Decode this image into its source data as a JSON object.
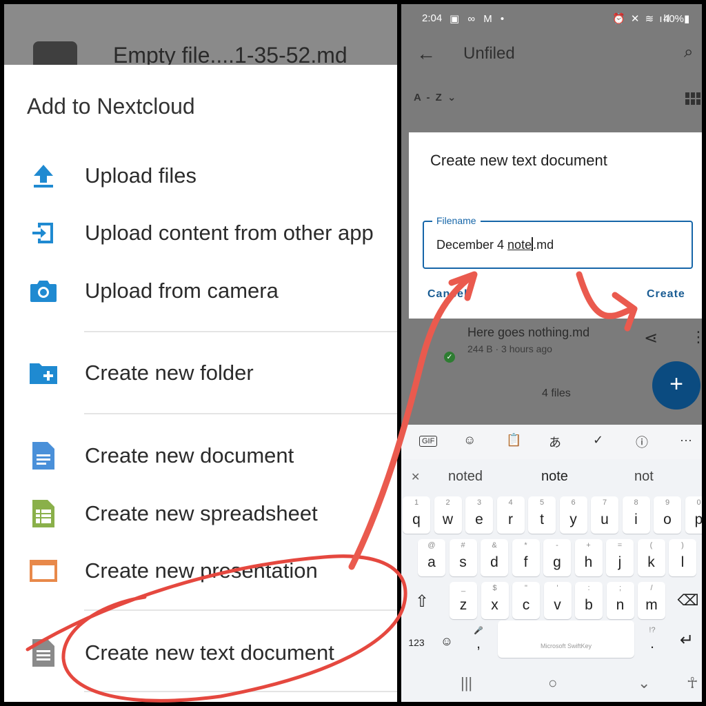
{
  "left": {
    "background_file": {
      "name": "Empty file....1-35-52.md"
    },
    "sheet": {
      "title": "Add to Nextcloud",
      "items": [
        {
          "label": "Upload files",
          "icon": "upload-icon"
        },
        {
          "label": "Upload content from other app",
          "icon": "upload-content-icon"
        },
        {
          "label": "Upload from camera",
          "icon": "camera-icon"
        },
        {
          "label": "Create new folder",
          "icon": "folder-add-icon"
        },
        {
          "label": "Create new document",
          "icon": "document-icon"
        },
        {
          "label": "Create new spreadsheet",
          "icon": "spreadsheet-icon"
        },
        {
          "label": "Create new presentation",
          "icon": "presentation-icon"
        },
        {
          "label": "Create new text document",
          "icon": "text-document-icon"
        }
      ]
    },
    "colors": {
      "blue": "#1f8ad1",
      "doc": "#4a90d9",
      "sheet": "#8ab04a",
      "presentation": "#e8894a",
      "text": "#8a8a8a"
    }
  },
  "right": {
    "status": {
      "time": "2:04",
      "left_icons": "▣ ∞ M •",
      "right_icons": "⏰ ✕ ≋ ıll",
      "battery": "40%▮"
    },
    "appbar": {
      "back": "←",
      "title": "Unfiled",
      "search": "⌕"
    },
    "sort": {
      "label": "A - Z ⌄"
    },
    "background_row": {
      "name": "Here goes nothing.md",
      "meta": "244 B · 3 hours ago",
      "share": "⋖",
      "more": "⋮"
    },
    "file_count": "4 files",
    "fab": "+",
    "dialog": {
      "title": "Create new text document",
      "field_label": "Filename",
      "field_value_prefix": "December 4 ",
      "field_value_word": "note",
      "field_value_suffix": ".md",
      "cancel": "Cancel",
      "create": "Create"
    },
    "keyboard": {
      "toolbar": [
        "GIF",
        "☺",
        "📋",
        "あ",
        "✓",
        "ⓘ",
        "···"
      ],
      "suggestions": {
        "close": "✕",
        "items": [
          "noted",
          "note",
          "not"
        ]
      },
      "rows": [
        [
          {
            "k": "q",
            "s": "1"
          },
          {
            "k": "w",
            "s": "2"
          },
          {
            "k": "e",
            "s": "3"
          },
          {
            "k": "r",
            "s": "4"
          },
          {
            "k": "t",
            "s": "5"
          },
          {
            "k": "y",
            "s": "6"
          },
          {
            "k": "u",
            "s": "7"
          },
          {
            "k": "i",
            "s": "8"
          },
          {
            "k": "o",
            "s": "9"
          },
          {
            "k": "p",
            "s": "0"
          }
        ],
        [
          {
            "k": "a",
            "s": "@"
          },
          {
            "k": "s",
            "s": "#"
          },
          {
            "k": "d",
            "s": "&"
          },
          {
            "k": "f",
            "s": "*"
          },
          {
            "k": "g",
            "s": "-"
          },
          {
            "k": "h",
            "s": "+"
          },
          {
            "k": "j",
            "s": "="
          },
          {
            "k": "k",
            "s": "("
          },
          {
            "k": "l",
            "s": ")"
          }
        ],
        [
          {
            "k": "z",
            "s": "_"
          },
          {
            "k": "x",
            "s": "$"
          },
          {
            "k": "c",
            "s": "\""
          },
          {
            "k": "v",
            "s": "'"
          },
          {
            "k": "b",
            "s": ":"
          },
          {
            "k": "n",
            "s": ";"
          },
          {
            "k": "m",
            "s": "/"
          }
        ]
      ],
      "shift": "⇧",
      "backspace": "⌫",
      "num_key": "123",
      "emoji_key": "☺",
      "comma_key": ",",
      "comma_sub": "🎤",
      "period_key": ".",
      "period_sub": "!?",
      "space_label": "Microsoft SwiftKey",
      "enter": "↵"
    },
    "navbar": {
      "recents": "|||",
      "home": "○",
      "back": "⌄",
      "accessibility": "☥"
    }
  }
}
